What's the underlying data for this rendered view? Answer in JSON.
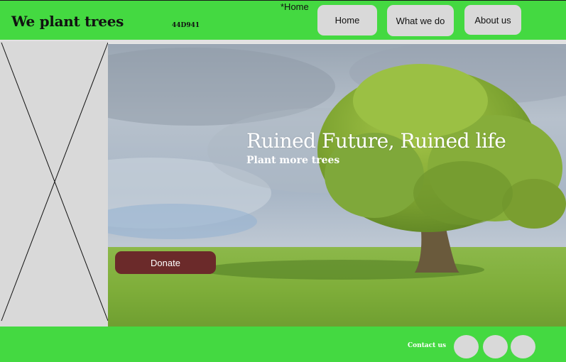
{
  "header": {
    "logo_text": "We plant trees",
    "hex_note": "44D941",
    "page_marker": "*Home",
    "nav": [
      {
        "label": "Home"
      },
      {
        "label": "What we do"
      },
      {
        "label": "About us"
      }
    ]
  },
  "hero": {
    "title": "Ruined Future, Ruined life",
    "subtitle": "Plant more trees",
    "donate_label": "Donate"
  },
  "footer": {
    "contact_label": "Contact us"
  },
  "colors": {
    "brand_green": "#44D941",
    "donate": "#6B2A2A",
    "placeholder": "#D9D9D9"
  }
}
